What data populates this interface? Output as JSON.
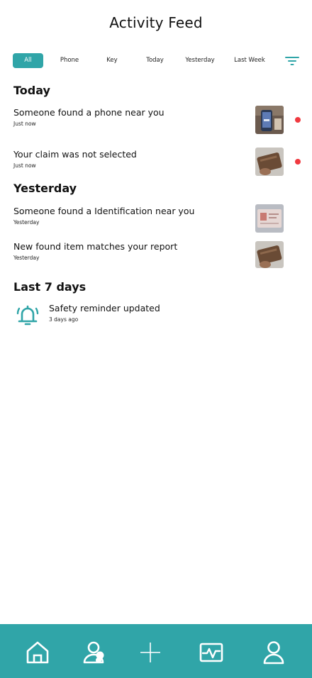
{
  "header": {
    "title": "Activity Feed"
  },
  "filters": [
    {
      "label": "All",
      "active": true
    },
    {
      "label": "Phone",
      "active": false
    },
    {
      "label": "Key",
      "active": false
    },
    {
      "label": "Today",
      "active": false
    },
    {
      "label": "Yesterday",
      "active": false
    },
    {
      "label": "Last Week",
      "active": false
    }
  ],
  "sections": {
    "today": {
      "title": "Today",
      "items": [
        {
          "title": "Someone found a phone near you",
          "time": "Just now",
          "unread": true
        },
        {
          "title": "Your claim was not selected",
          "time": "Just now",
          "unread": true
        }
      ]
    },
    "yesterday": {
      "title": "Yesterday",
      "items": [
        {
          "title": "Someone found a Identification near you",
          "time": "Yesterday",
          "unread": false
        },
        {
          "title": "New found item matches your report",
          "time": "Yesterday",
          "unread": false
        }
      ]
    },
    "last7": {
      "title": "Last 7 days",
      "items": [
        {
          "title": "Safety reminder updated",
          "time": "3 days ago",
          "icon": "bell-icon"
        }
      ]
    }
  },
  "tabbar": {
    "items": [
      "home-icon",
      "users-icon",
      "plus-icon",
      "activity-icon",
      "profile-icon"
    ]
  },
  "colors": {
    "accent": "#30a5a8",
    "unread_dot": "#f0393f"
  }
}
